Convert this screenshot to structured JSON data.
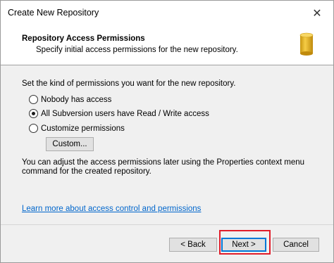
{
  "window": {
    "title": "Create New Repository",
    "close_label": "✕"
  },
  "header": {
    "title": "Repository Access Permissions",
    "subtitle": "Specify initial access permissions for the new repository.",
    "icon": "database-icon",
    "icon_color": "#e8b92a"
  },
  "content": {
    "intro": "Set the kind of permissions you want for the new repository.",
    "options": [
      {
        "label": "Nobody has access",
        "checked": false
      },
      {
        "label": "All Subversion users have Read / Write access",
        "checked": true
      },
      {
        "label": "Customize permissions",
        "checked": false
      }
    ],
    "custom_button": "Custom...",
    "note": "You can adjust the access permissions later using the Properties context menu command for the created repository.",
    "link": "Learn more about access control and permissions"
  },
  "footer": {
    "back_button": "< Back",
    "next_button": "Next >",
    "cancel_button": "Cancel",
    "highlight_color": "#e11d2a"
  }
}
